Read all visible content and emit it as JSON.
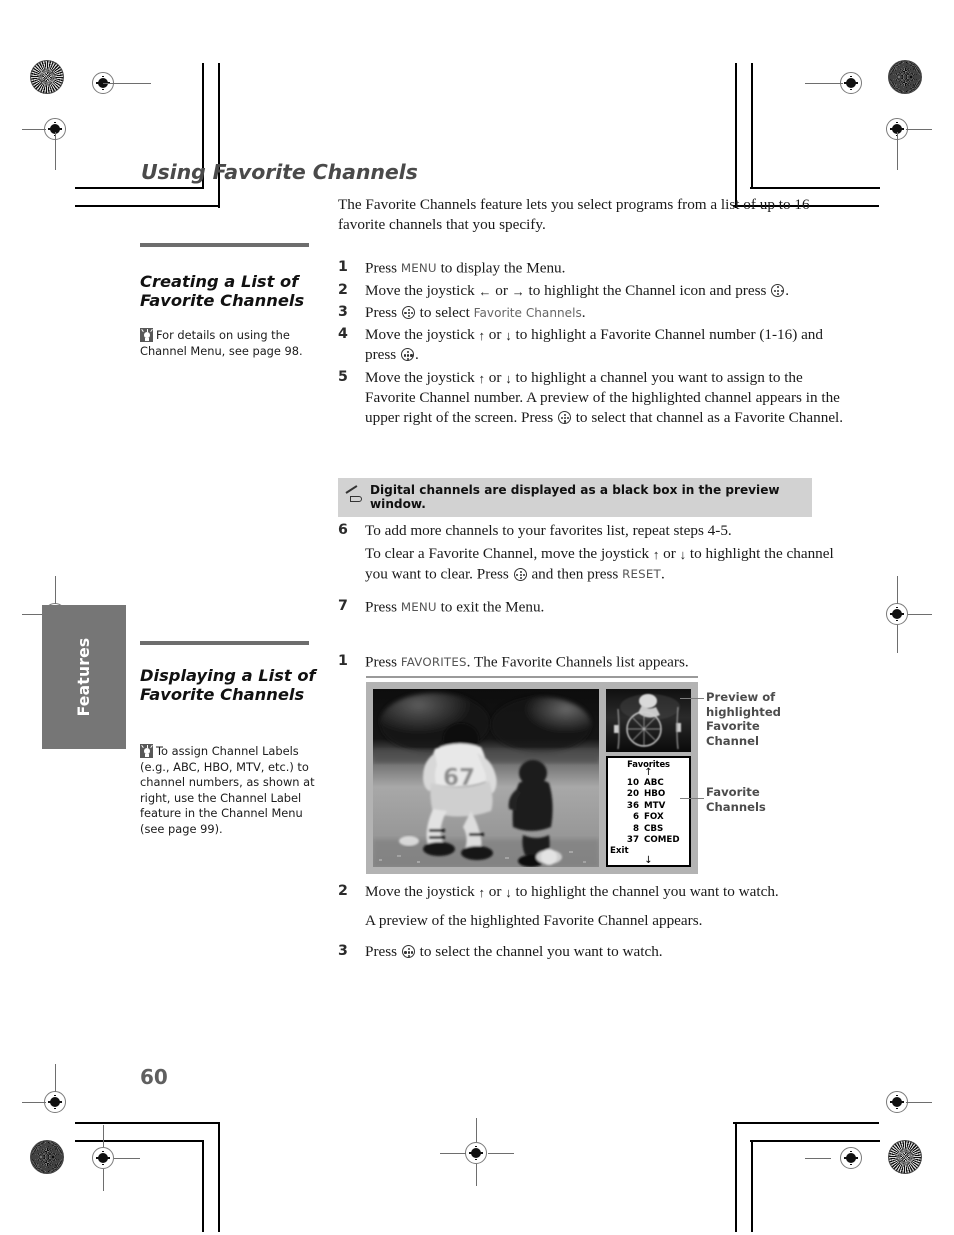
{
  "page": {
    "title": "Using Favorite Channels",
    "folio": "60",
    "chapter_tab": "Features"
  },
  "intro": "The Favorite Channels feature lets you select programs from a list of up to 16 favorite channels that you specify.",
  "section1": {
    "heading": "Creating a List of Favorite Channels",
    "tip": "For details on using the Channel Menu, see page 98.",
    "tip_icon": "lightbulb-icon",
    "steps": [
      {
        "num": "1",
        "text_a": "Press ",
        "key": "MENU",
        "text_b": " to display the Menu."
      },
      {
        "num": "2",
        "text_a": "Move the joystick ",
        "arrow_left": "←",
        "text_b": " or ",
        "arrow_right": "→",
        "text_c": " to highlight the Channel icon and press ",
        "text_d": "."
      },
      {
        "num": "3",
        "text_a": "Press ",
        "text_b": " to select ",
        "uiname": "Favorite Channels",
        "text_c": "."
      },
      {
        "num": "4",
        "text_a": "Move the joystick ",
        "arrow_up": "↑",
        "text_b": " or ",
        "arrow_down": "↓",
        "text_c": " to highlight a Favorite Channel number (1-16) and press ",
        "text_d": "."
      },
      {
        "num": "5",
        "text_a": "Move the joystick ",
        "arrow_up": "↑",
        "text_b": " or ",
        "arrow_down": "↓",
        "text_c": " to highlight a channel you want to assign to the Favorite Channel number. A preview of the highlighted channel appears in the upper right of the screen. Press ",
        "text_d": " to select that channel as a Favorite Channel."
      },
      {
        "num": "6",
        "line1": "To add more channels to your favorites list, repeat steps 4-5.",
        "text_a": "To clear a Favorite Channel, move the joystick ",
        "arrow_up": "↑",
        "text_b": " or ",
        "arrow_down": "↓",
        "text_c": " to highlight the channel you want to clear. Press ",
        "text_d": " and then press ",
        "key": "RESET",
        "text_e": "."
      },
      {
        "num": "7",
        "text_a": "Press ",
        "key": "MENU",
        "text_b": " to exit the Menu."
      }
    ],
    "note": {
      "icon": "pencil-note-icon",
      "text": "Digital channels are displayed as a black box in the preview window."
    }
  },
  "section2": {
    "heading": "Displaying a List of Favorite Channels",
    "tip": "To assign Channel Labels (e.g., ABC, HBO, MTV, etc.) to channel numbers, as shown at right, use the Channel Label feature in the Channel Menu (see page 99).",
    "tip_icon": "lightbulb-icon",
    "steps": [
      {
        "num": "1",
        "text_a": "Press ",
        "key": "FAVORITES",
        "text_b": ". The Favorite Channels list appears."
      },
      {
        "num": "2",
        "text_a": "Move the joystick ",
        "arrow_up": "↑",
        "text_b": " or ",
        "arrow_down": "↓",
        "text_c": " to highlight the channel you want to watch.",
        "line2": "A preview of the highlighted Favorite Channel appears."
      },
      {
        "num": "3",
        "text_a": "Press ",
        "text_b": " to select the channel you want to watch."
      }
    ]
  },
  "figure": {
    "preview_callout": "Preview of highlighted Favorite Channel",
    "list_callout": "Favorite Channels",
    "osd": {
      "title": "Favorites",
      "scroll_up": "↑",
      "scroll_down": "↓",
      "exit_label": "Exit",
      "rows": [
        {
          "number": "10",
          "label": "ABC",
          "selected": false
        },
        {
          "number": "20",
          "label": "HBO",
          "selected": false
        },
        {
          "number": "36",
          "label": "MTV",
          "selected": false
        },
        {
          "number": "6",
          "label": "FOX",
          "selected": true
        },
        {
          "number": "8",
          "label": "CBS",
          "selected": false
        },
        {
          "number": "37",
          "label": "COMED",
          "selected": false
        }
      ]
    }
  },
  "colors": {
    "title_gray": "#4a4a4a",
    "rule_gray": "#6d6d6d",
    "note_bg": "#d2d2d2",
    "tab_gray": "#767676",
    "figure_bg": "#b3b3b3",
    "callout_gray": "#4c4c4c"
  }
}
